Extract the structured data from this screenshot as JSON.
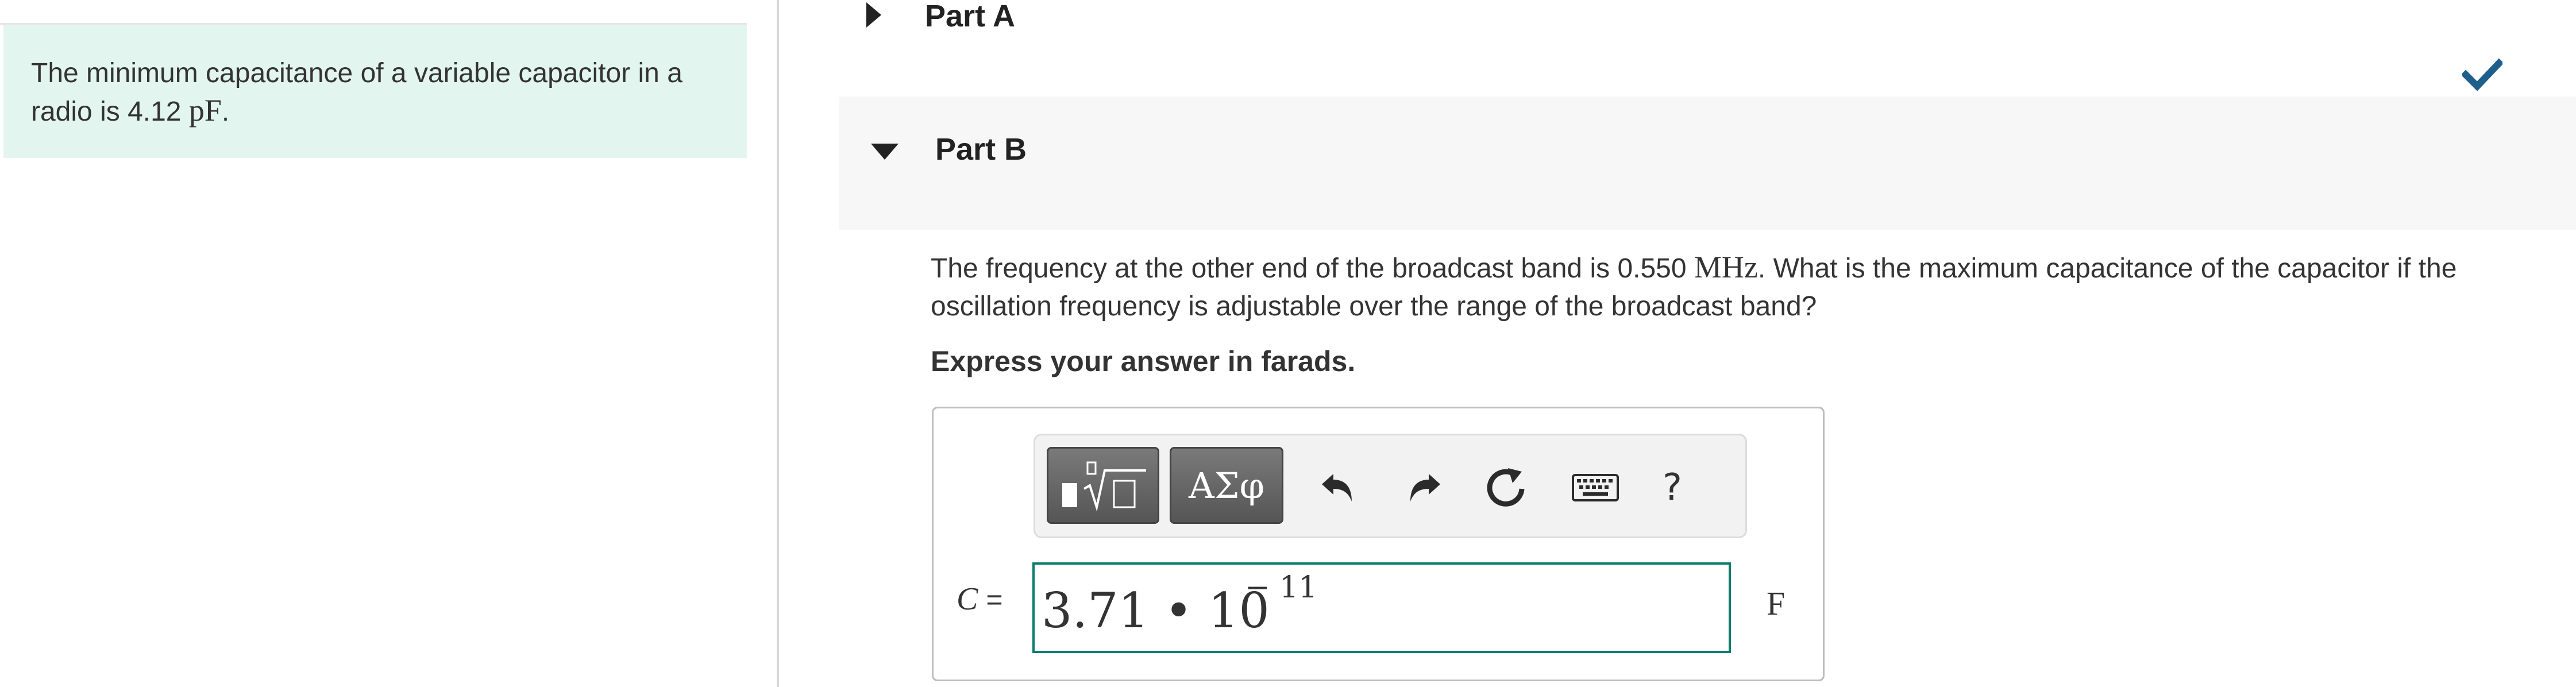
{
  "intro": {
    "text_before": "The minimum capacitance of a variable capacitor in a radio is 4.12 ",
    "unit": "pF",
    "text_after": "."
  },
  "part_a": {
    "title": "Part A",
    "status_icon": "check-icon",
    "status_color": "#1f5f8b"
  },
  "part_b": {
    "title": "Part B",
    "question_before": "The frequency at the other end of the broadcast band is 0.550 ",
    "question_unit": "MHz",
    "question_after": ". What is the maximum capacitance of the capacitor if the oscillation frequency is adjustable over the range of the broadcast band?",
    "instruction": "Express your answer in farads."
  },
  "toolbar": {
    "template_button_icon": "templates-icon",
    "greek_button_label": "ΑΣφ",
    "undo_icon": "undo-icon",
    "redo_icon": "redo-icon",
    "reset_icon": "reset-icon",
    "keyboard_icon": "keyboard-icon",
    "help_label": "?"
  },
  "answer": {
    "variable": "C",
    "equals": "=",
    "mantissa": "3.71 • 10",
    "exponent": "− 11",
    "unit": "F"
  },
  "colors": {
    "intro_background": "#e3f5ef",
    "input_border": "#0a7d6e",
    "header_background": "#f7f7f7"
  }
}
